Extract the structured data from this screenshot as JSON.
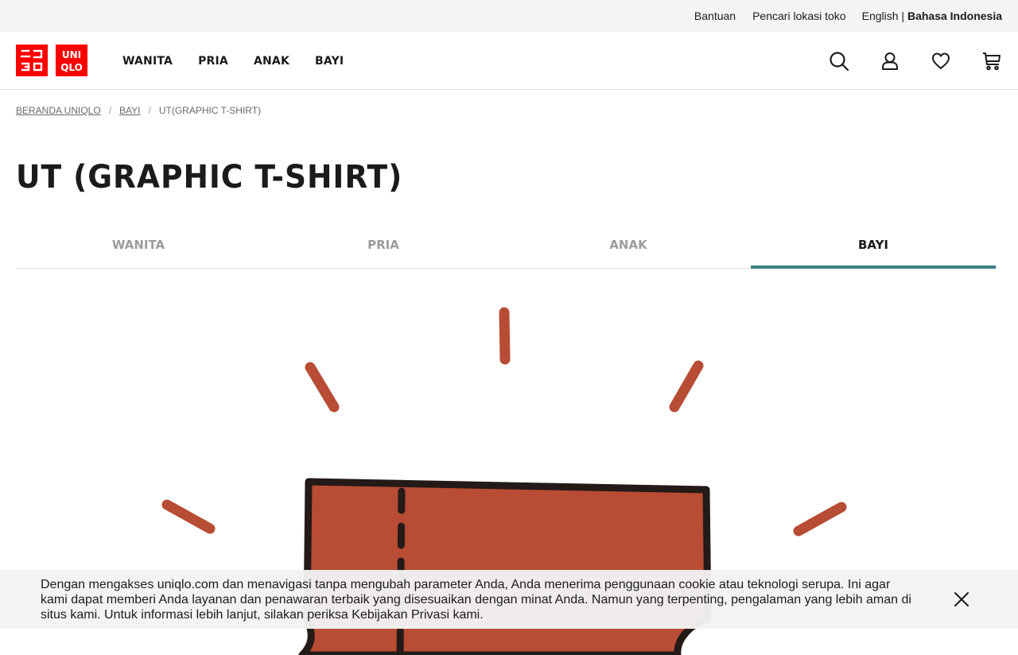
{
  "utility_bar": {
    "help": "Bantuan",
    "store_locator": "Pencari lokasi toko",
    "lang_english": "English",
    "lang_divider": "|",
    "lang_indonesian": "Bahasa Indonesia"
  },
  "logo": {
    "top_text": "ユニクロ",
    "bottom_text": "UNIQLO"
  },
  "main_nav": [
    "WANITA",
    "PRIA",
    "ANAK",
    "BAYI"
  ],
  "header_icons": [
    "search-icon",
    "account-icon",
    "wishlist-heart-icon",
    "cart-icon"
  ],
  "breadcrumb": {
    "home": "BERANDA UNIQLO",
    "separator": "/",
    "section": "BAYI",
    "current": "UT(GRAPHIC T-SHIRT)"
  },
  "page_title": "UT (GRAPHIC T-SHIRT)",
  "category_tabs": [
    {
      "label": "WANITA",
      "active": false
    },
    {
      "label": "PRIA",
      "active": false
    },
    {
      "label": "ANAK",
      "active": false
    },
    {
      "label": "BAYI",
      "active": true
    }
  ],
  "cookie_notice": {
    "text": "Dengan mengakses uniqlo.com dan menavigasi tanpa mengubah parameter Anda, Anda menerima penggunaan cookie atau teknologi serupa. Ini agar kami dapat memberi Anda layanan dan penawaran terbaik yang disesuaikan dengan minat Anda. Namun yang terpenting, pengalaman yang lebih aman di situs kami. Untuk informasi lebih lanjut, silakan periksa Kebijakan Privasi kami."
  },
  "colors": {
    "brand_red": "#ff0000",
    "active_tab_underline": "#3b7f86",
    "illustration_orange": "#b84c34",
    "utility_bg": "#f4f4f4"
  }
}
